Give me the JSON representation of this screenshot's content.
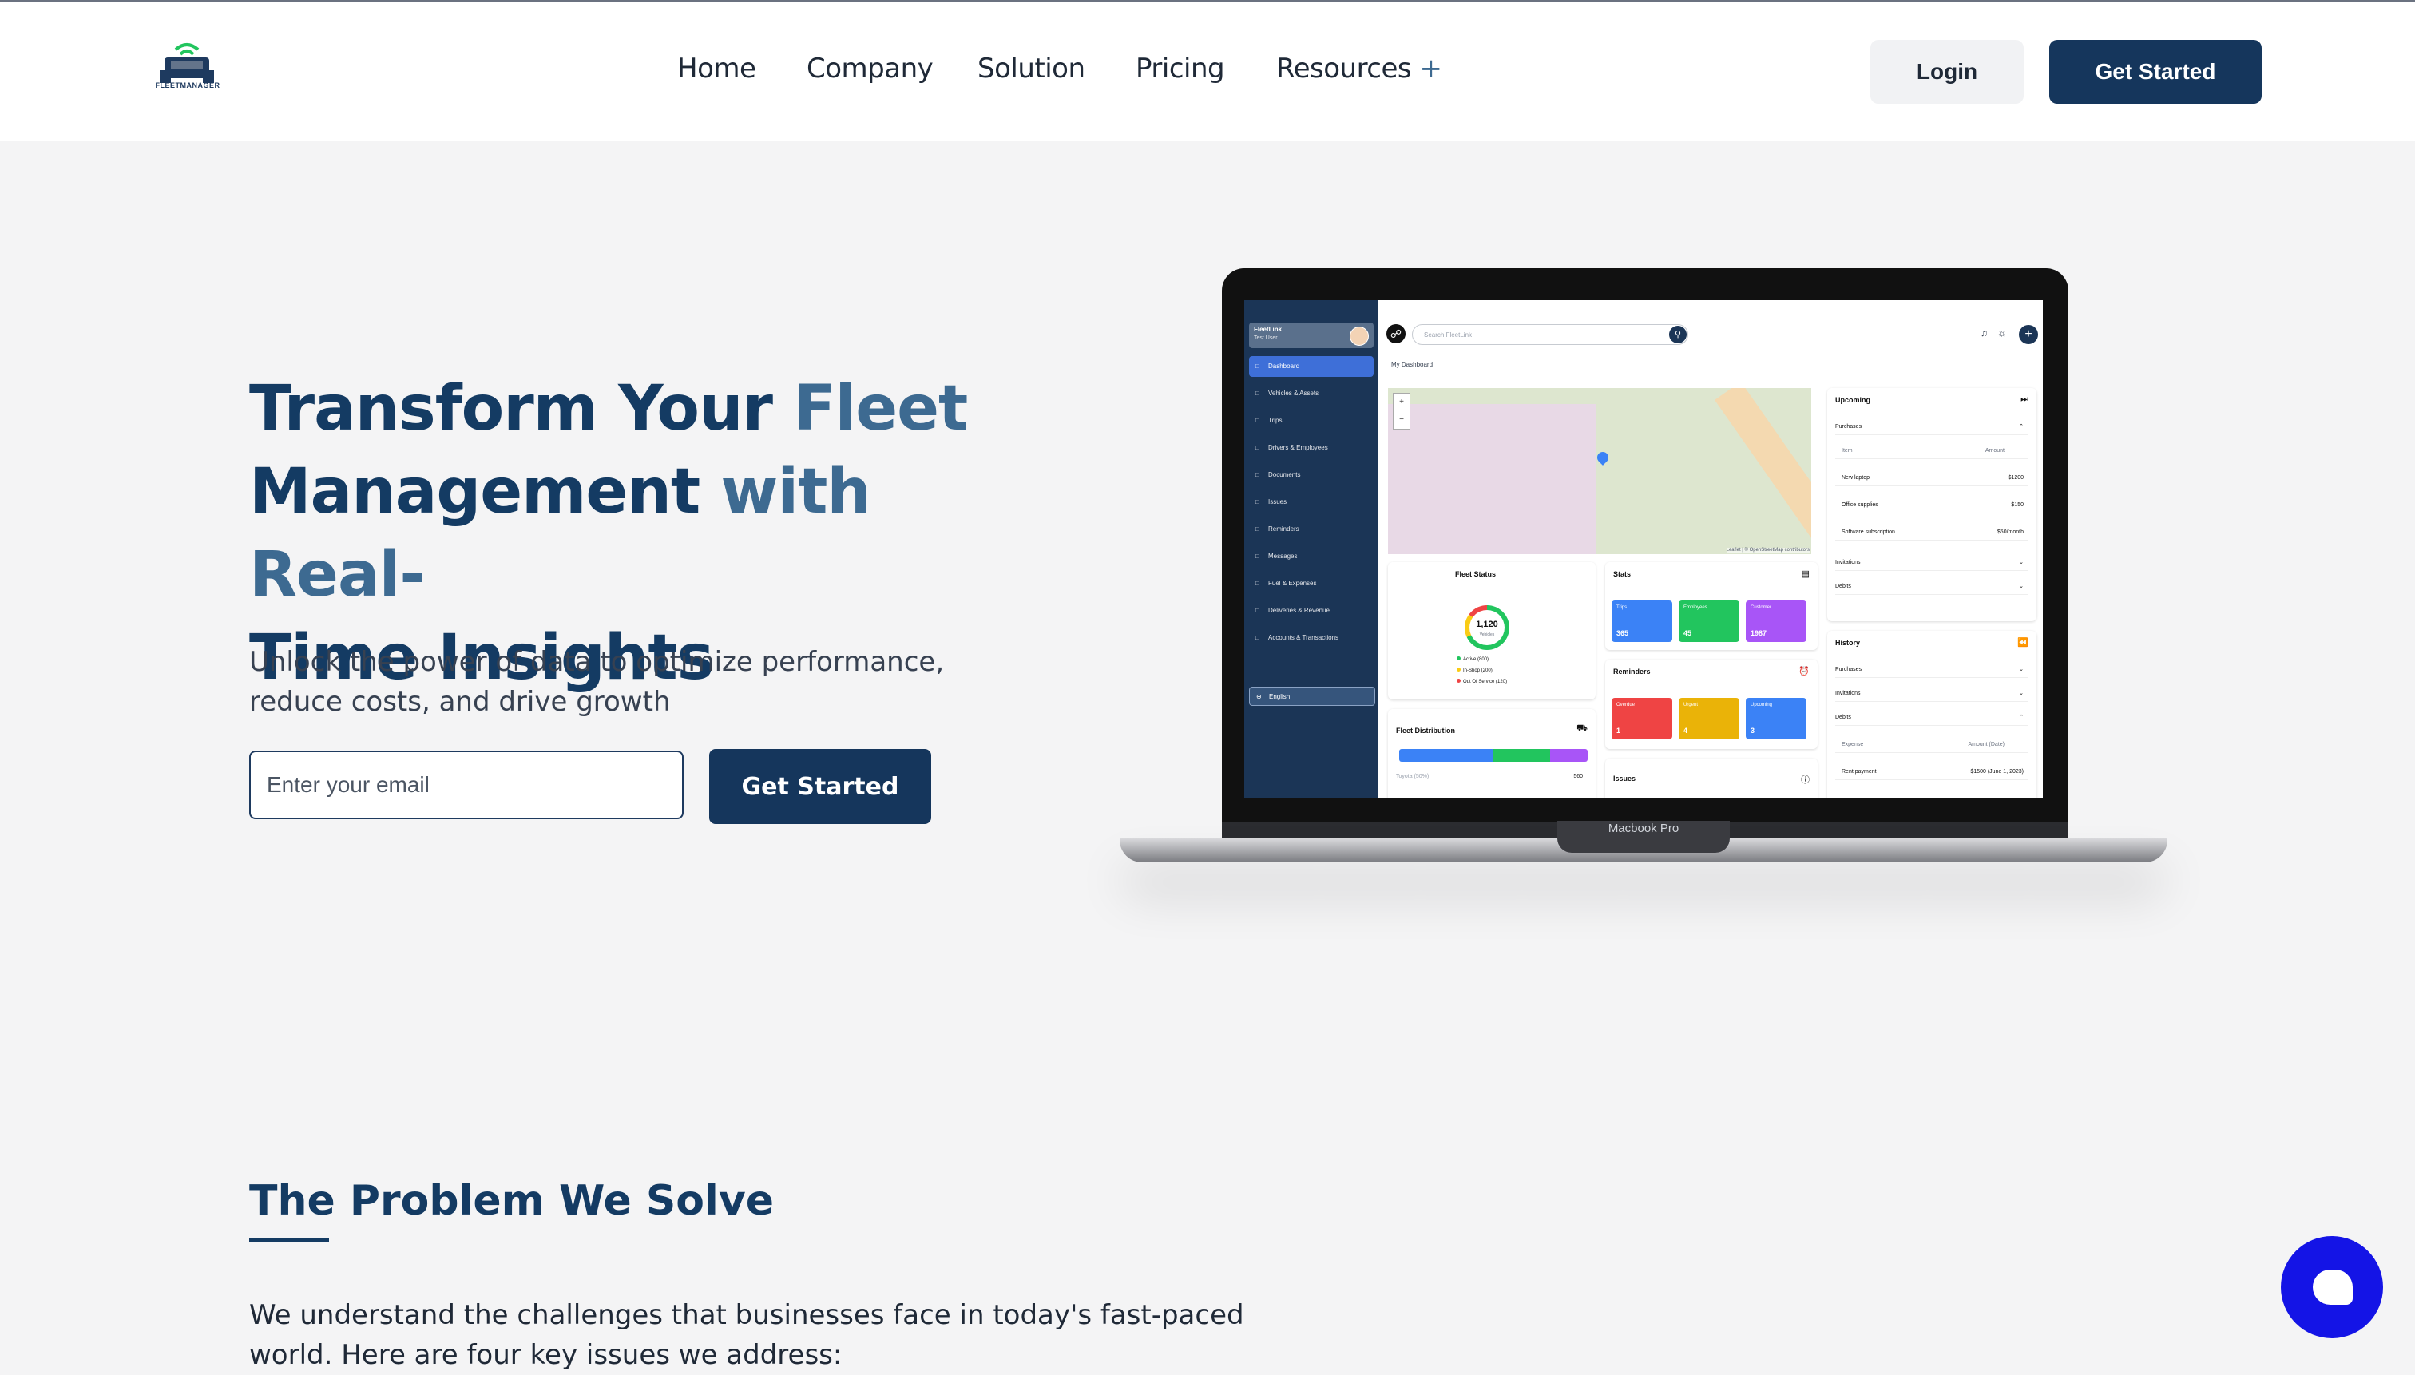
{
  "nav": {
    "logo_text": "FLEETMANAGER",
    "items": [
      "Home",
      "Company",
      "Solution",
      "Pricing",
      "Resources"
    ],
    "resources_plus": "+",
    "login_label": "Login",
    "get_started_label": "Get Started"
  },
  "hero": {
    "title_part1": "Transform Your ",
    "title_part2": "Fleet",
    "title_part3": "Management ",
    "title_part4": "with Real-",
    "title_part5": "Time Insights",
    "subtitle": "Unlock the power of data to optimize performance, reduce costs, and drive growth",
    "email_placeholder": "Enter your email",
    "cta_label": "Get Started"
  },
  "laptop": {
    "model_label": "Macbook Pro",
    "dashboard": {
      "brand": "FleetLink",
      "user": "Test User",
      "menu": [
        "Dashboard",
        "Vehicles & Assets",
        "Trips",
        "Drivers & Employees",
        "Documents",
        "Issues",
        "Reminders",
        "Messages",
        "Fuel & Expenses",
        "Deliveries & Revenue",
        "Accounts & Transactions"
      ],
      "language": "English",
      "search_placeholder": "Search FleetLink",
      "view_select": "My Dashboard",
      "map_attribution": "Leaflet | © OpenStreetMap contributors",
      "fleet_status": {
        "title": "Fleet Status",
        "total": "1,120",
        "total_label": "Vehicles",
        "legend": [
          "Active (800)",
          "In-Shop (200)",
          "Out Of Service (120)"
        ]
      },
      "stats": {
        "title": "Stats",
        "tiles": [
          {
            "label": "Trips",
            "value": "365",
            "color": "#3b82f6"
          },
          {
            "label": "Employees",
            "value": "45",
            "color": "#22c55e"
          },
          {
            "label": "Customer",
            "value": "1987",
            "color": "#a855f7"
          }
        ]
      },
      "reminders": {
        "title": "Reminders",
        "tiles": [
          {
            "label": "Overdue",
            "value": "1",
            "color": "#ef4444"
          },
          {
            "label": "Urgent",
            "value": "4",
            "color": "#eab308"
          },
          {
            "label": "Upcoming",
            "value": "3",
            "color": "#3b82f6"
          }
        ]
      },
      "fleet_distribution": {
        "title": "Fleet Distribution",
        "row_label": "Toyota (50%)",
        "row_value": "560"
      },
      "issues_title": "Issues",
      "upcoming": {
        "title": "Upcoming",
        "section": "Purchases",
        "col_item": "Item",
        "col_amount": "Amount",
        "rows": [
          {
            "item": "New laptop",
            "amount": "$1200"
          },
          {
            "item": "Office supplies",
            "amount": "$150"
          },
          {
            "item": "Software subscription",
            "amount": "$50/month"
          }
        ],
        "others": [
          "Invitations",
          "Debits"
        ]
      },
      "history": {
        "title": "History",
        "sections": [
          "Purchases",
          "Invitations",
          "Debits"
        ],
        "col_expense": "Expense",
        "col_amount": "Amount (Date)",
        "row_item": "Rent payment",
        "row_amount": "$1500 (June 1, 2023)"
      }
    }
  },
  "problem": {
    "title": "The Problem We Solve",
    "text": "We understand the challenges that businesses face in today's fast-paced world. Here are four key issues we address:"
  },
  "colors": {
    "brand_dark": "#15365c",
    "brand_light": "#3d6a91",
    "chat": "#1414e6"
  }
}
